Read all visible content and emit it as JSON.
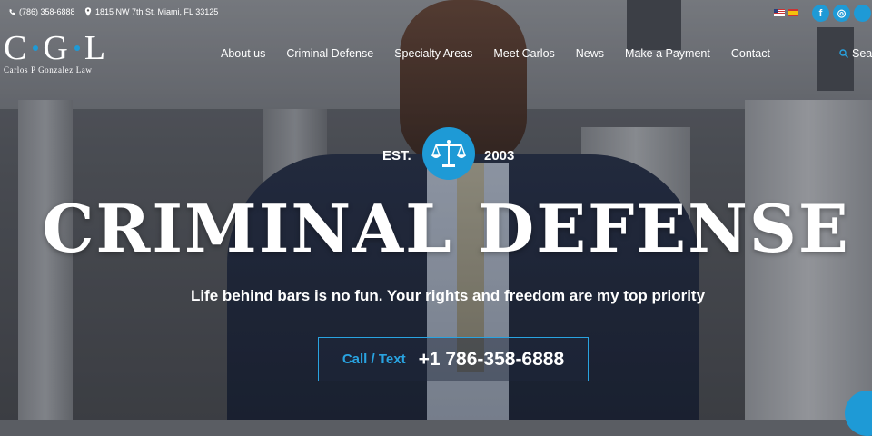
{
  "topbar": {
    "phone": "(786) 358-6888",
    "phone_icon": "phone-icon",
    "address": "1815 NW 7th St, Miami, FL 33125",
    "address_icon": "map-pin-icon"
  },
  "languages": [
    {
      "name": "us-flag-icon"
    },
    {
      "name": "spain-flag-icon"
    }
  ],
  "social": [
    {
      "icon": "facebook-icon",
      "glyph": "f"
    },
    {
      "icon": "instagram-icon",
      "glyph": "◎"
    },
    {
      "icon": "twitter-icon",
      "glyph": ""
    }
  ],
  "logo": {
    "letters": [
      "C",
      "G",
      "L"
    ],
    "subtitle": "Carlos P Gonzalez Law"
  },
  "nav": {
    "items": [
      "About us",
      "Criminal Defense",
      "Specialty Areas",
      "Meet Carlos",
      "News",
      "Make a Payment",
      "Contact"
    ],
    "search_label": "Sea"
  },
  "hero": {
    "est_label": "EST.",
    "est_year": "2003",
    "badge_icon": "scales-of-justice-icon",
    "title": "CRIMINAL DEFENSE",
    "tagline": "Life behind bars is no fun. Your rights and freedom are my top priority",
    "cta_label": "Call / Text",
    "cta_number": "+1 786-358-6888"
  },
  "colors": {
    "accent": "#1e9ad6",
    "cta_border": "#29a3e0"
  }
}
